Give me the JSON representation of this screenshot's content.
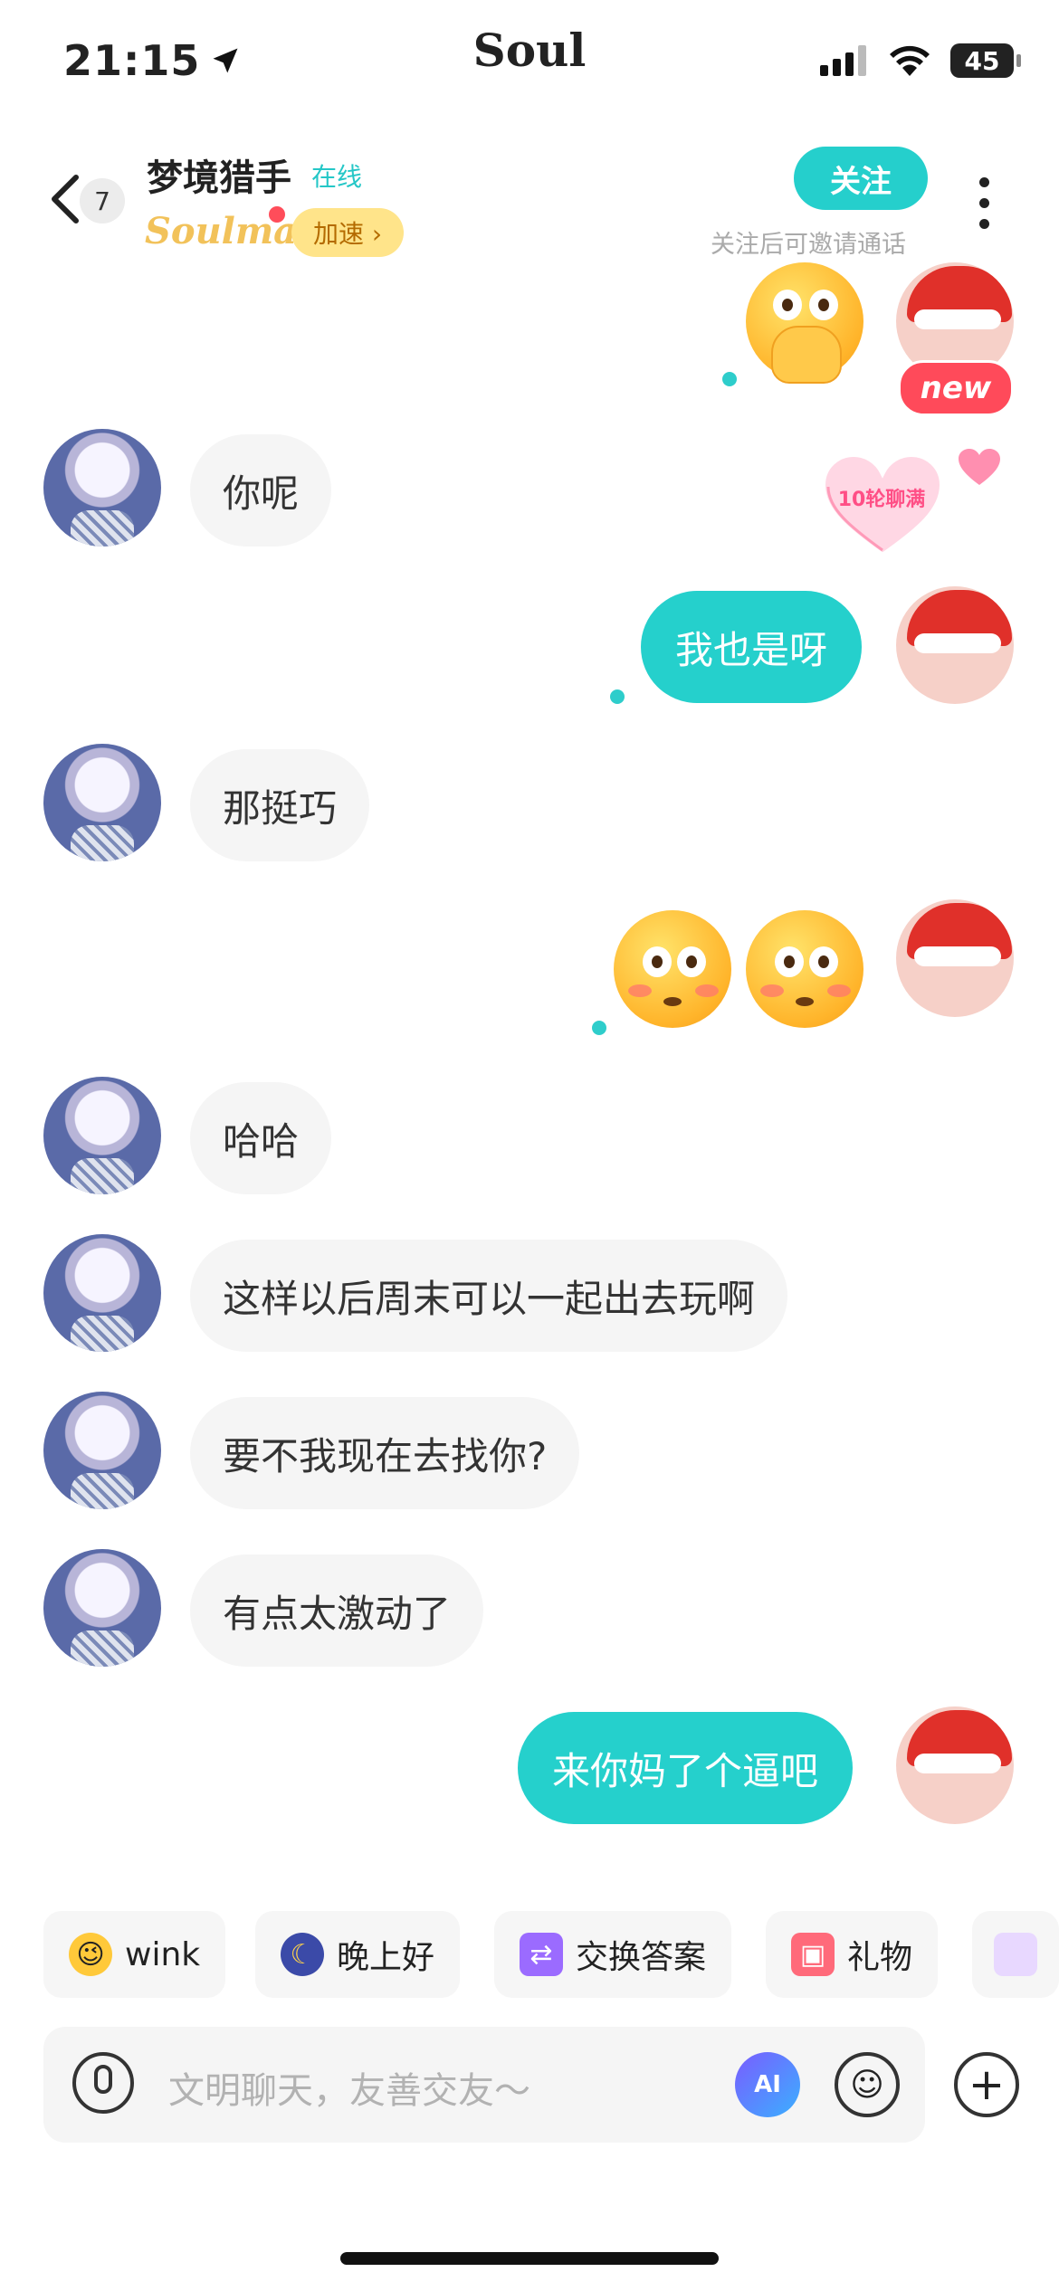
{
  "status_bar": {
    "time": "21:15",
    "app": "Soul",
    "battery": "45"
  },
  "header": {
    "unread": "7",
    "nickname": "梦境猎手",
    "online": "在线",
    "soulmate": "Soulmate",
    "speed": "加速 ›",
    "follow": "关注",
    "follow_tip": "关注后可邀请通话"
  },
  "badges": {
    "new": "new",
    "rounds": "10轮聊满"
  },
  "messages": [
    {
      "side": "in",
      "text": "你呢"
    },
    {
      "side": "out",
      "text": "我也是呀"
    },
    {
      "side": "in",
      "text": "那挺巧"
    },
    {
      "side": "in",
      "text": "哈哈"
    },
    {
      "side": "in",
      "text": "这样以后周末可以一起出去玩啊"
    },
    {
      "side": "in",
      "text": "要不我现在去找你?"
    },
    {
      "side": "in",
      "text": "有点太激动了"
    },
    {
      "side": "out",
      "text": "来你妈了个逼吧"
    }
  ],
  "quick_chips": [
    {
      "icon": "wink-emoji-icon",
      "label": "wink"
    },
    {
      "icon": "moon-icon",
      "label": "晚上好"
    },
    {
      "icon": "exchange-icon",
      "label": "交换答案"
    },
    {
      "icon": "gift-icon",
      "label": "礼物"
    }
  ],
  "input": {
    "placeholder": "文明聊天，友善交友～",
    "ai_label": "AI"
  },
  "colors": {
    "accent": "#25d0cc",
    "badge_red": "#ff4a5a",
    "speed_bg": "#ffe48a"
  }
}
